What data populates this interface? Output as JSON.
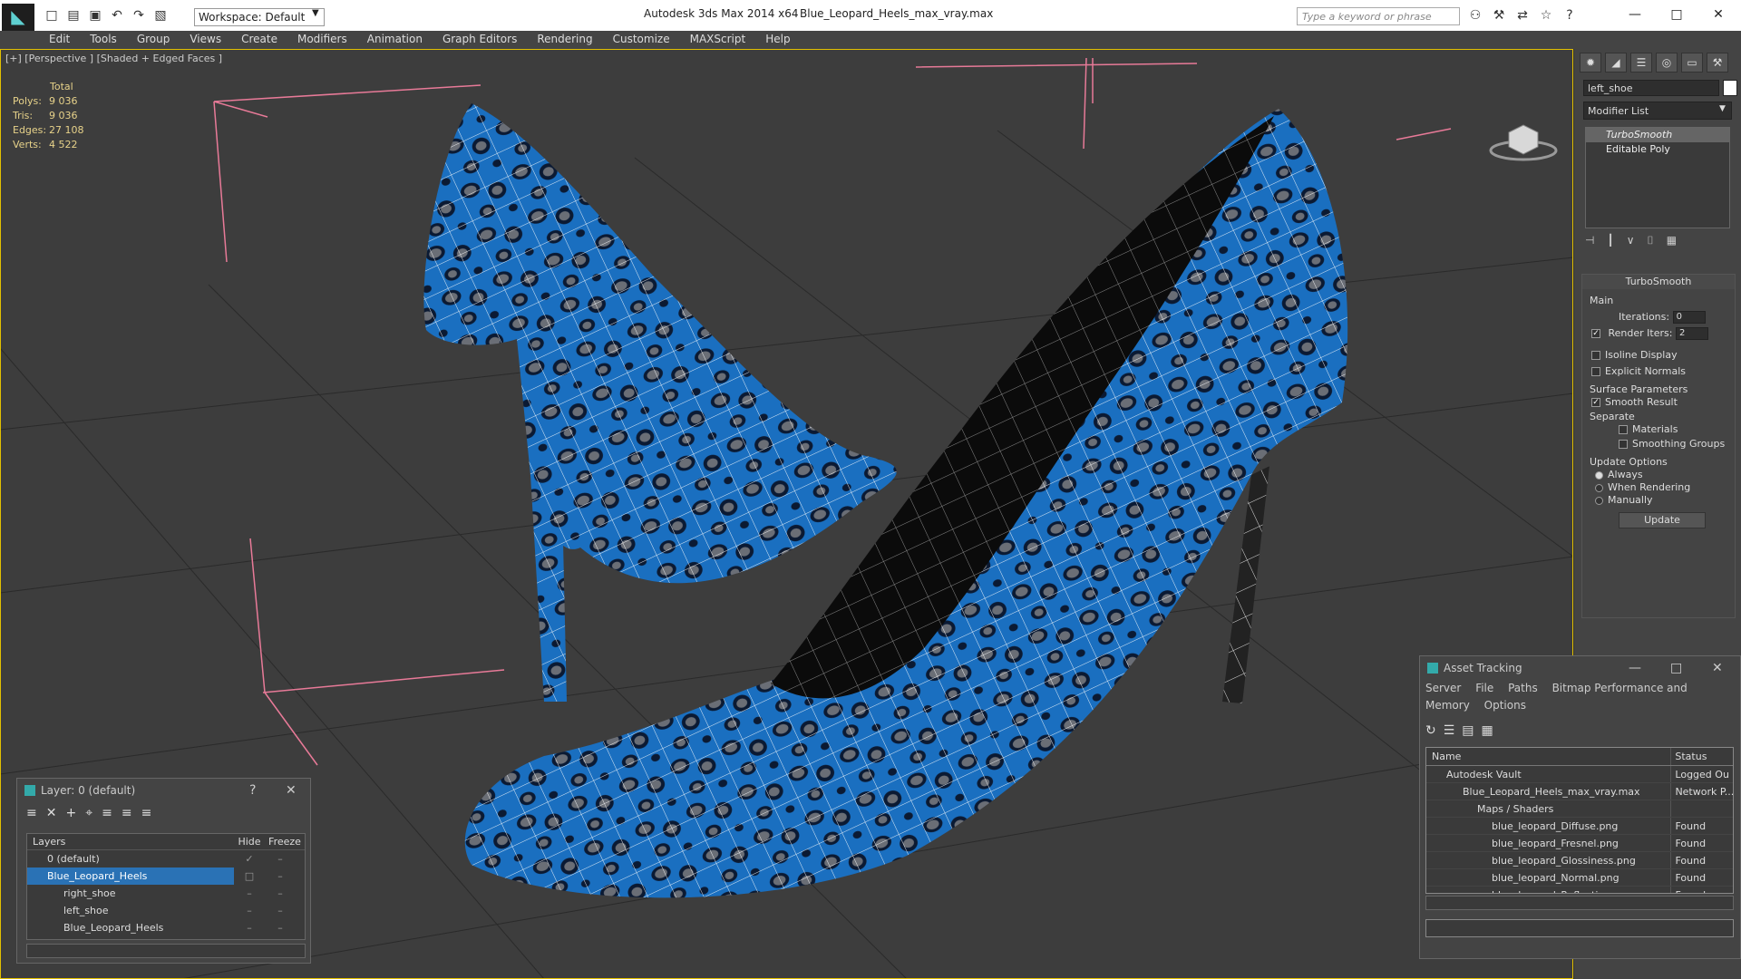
{
  "app": {
    "title": "Autodesk 3ds Max  2014 x64",
    "file": "Blue_Leopard_Heels_max_vray.max",
    "workspace": "Workspace: Default",
    "search_placeholder": "Type a keyword or phrase"
  },
  "menu": [
    "Edit",
    "Tools",
    "Group",
    "Views",
    "Create",
    "Modifiers",
    "Animation",
    "Graph Editors",
    "Rendering",
    "Customize",
    "MAXScript",
    "Help"
  ],
  "viewport": {
    "label": "[+] [Perspective ] [Shaded + Edged Faces ]",
    "stats": {
      "header": "Total",
      "rows": [
        {
          "k": "Polys:",
          "v": "9 036"
        },
        {
          "k": "Tris:",
          "v": "9 036"
        },
        {
          "k": "Edges:",
          "v": "27 108"
        },
        {
          "k": "Verts:",
          "v": "4 522"
        }
      ]
    }
  },
  "command_panel": {
    "object_name": "left_shoe",
    "modifier_list": "Modifier List",
    "stack": [
      "TurboSmooth",
      "Editable Poly"
    ],
    "rollout_title": "TurboSmooth",
    "main_label": "Main",
    "iterations_label": "Iterations:",
    "iterations_value": "0",
    "render_iters_label": "Render Iters:",
    "render_iters_value": "2",
    "isoline": "Isoline Display",
    "explicit_normals": "Explicit Normals",
    "surface_params": "Surface Parameters",
    "smooth_result": "Smooth Result",
    "separate": "Separate",
    "materials": "Materials",
    "smoothing_groups": "Smoothing Groups",
    "update_options": "Update Options",
    "always": "Always",
    "when_rendering": "When Rendering",
    "manually": "Manually",
    "update_button": "Update"
  },
  "layer_panel": {
    "title": "Layer: 0 (default)",
    "help": "?",
    "col_layers": "Layers",
    "col_hide": "Hide",
    "col_freeze": "Freeze",
    "rows": [
      "0 (default)",
      "Blue_Leopard_Heels",
      "right_shoe",
      "left_shoe",
      "Blue_Leopard_Heels"
    ]
  },
  "asset_panel": {
    "title": "Asset Tracking",
    "menu": [
      "Server",
      "File",
      "Paths",
      "Bitmap Performance and Memory",
      "Options"
    ],
    "col_name": "Name",
    "col_status": "Status",
    "rows": [
      {
        "name": "Autodesk Vault",
        "status": "Logged Ou"
      },
      {
        "name": "Blue_Leopard_Heels_max_vray.max",
        "status": "Network P..."
      },
      {
        "name": "Maps / Shaders",
        "status": ""
      },
      {
        "name": "blue_leopard_Diffuse.png",
        "status": "Found"
      },
      {
        "name": "blue_leopard_Fresnel.png",
        "status": "Found"
      },
      {
        "name": "blue_leopard_Glossiness.png",
        "status": "Found"
      },
      {
        "name": "blue_leopard_Normal.png",
        "status": "Found"
      },
      {
        "name": "blue_leopard_Reflection.png",
        "status": "Found"
      }
    ]
  },
  "colors": {
    "viewport_bg": "#3d3d3d",
    "shoe_blue": "#1a6fc0",
    "spot_gray": "#6a6e76",
    "spot_dark": "#0b1a33",
    "selection": "#2a72b5",
    "stats": "#e7d28a"
  }
}
